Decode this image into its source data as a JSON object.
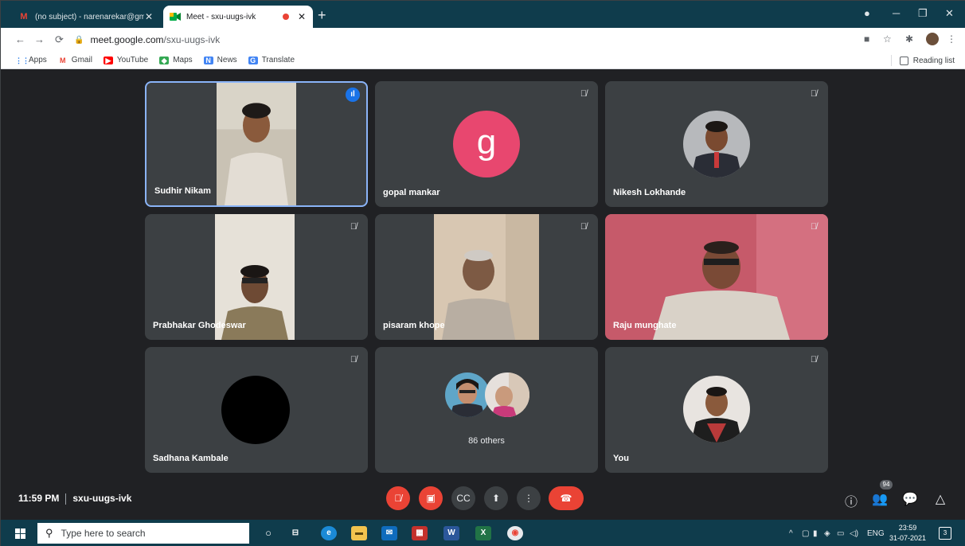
{
  "browser": {
    "tabs": [
      {
        "title": "(no subject) - narenarekar@gmai",
        "favicon": "gmail-icon",
        "active": false
      },
      {
        "title": "Meet - sxu-uugs-ivk",
        "favicon": "meet-icon",
        "active": true
      }
    ],
    "url_host": "meet.google.com",
    "url_path": "/sxu-uugs-ivk",
    "bookmarks": [
      {
        "label": "Apps",
        "icon": "apps-grid-icon"
      },
      {
        "label": "Gmail",
        "icon": "gmail-icon"
      },
      {
        "label": "YouTube",
        "icon": "youtube-icon"
      },
      {
        "label": "Maps",
        "icon": "maps-icon"
      },
      {
        "label": "News",
        "icon": "news-icon"
      },
      {
        "label": "Translate",
        "icon": "translate-icon"
      }
    ],
    "reading_list": "Reading list"
  },
  "meet": {
    "participants": [
      {
        "name": "Sudhir Nikam",
        "speaking": true
      },
      {
        "name": "gopal mankar",
        "avatar_letter": "g",
        "muted": true
      },
      {
        "name": "Nikesh Lokhande",
        "muted": true
      },
      {
        "name": "Prabhakar Ghodeswar",
        "muted": true
      },
      {
        "name": "pisaram khope",
        "muted": true
      },
      {
        "name": "Raju munghate",
        "muted": true
      },
      {
        "name": "Sadhana Kambale",
        "muted": true
      },
      {
        "name": "86 others"
      },
      {
        "name": "You",
        "muted": true
      }
    ],
    "time": "11:59 PM",
    "meeting_code": "sxu-uugs-ivk",
    "people_count": "94",
    "colors": {
      "end_call": "#ea4335",
      "speaking_border": "#8ab4f8",
      "letter_avatar": "#e8476f"
    }
  },
  "taskbar": {
    "search_placeholder": "Type here to search",
    "language": "ENG",
    "clock_time": "23:59",
    "clock_date": "31-07-2021",
    "notification_count": "3"
  }
}
